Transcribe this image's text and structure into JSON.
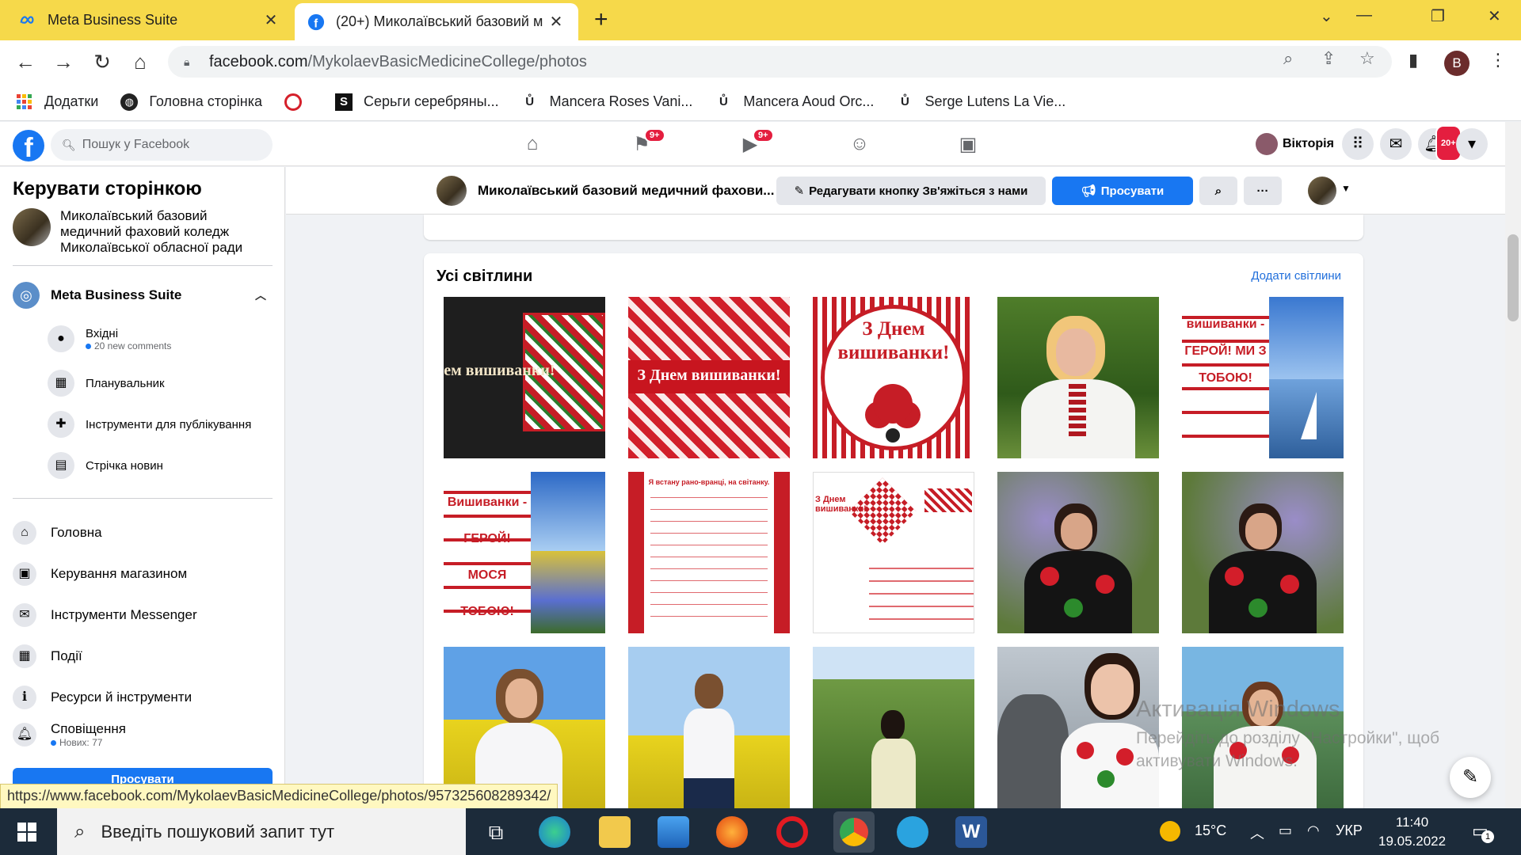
{
  "browser": {
    "tabs": [
      {
        "title": "Meta Business Suite",
        "active": false
      },
      {
        "title": "(20+) Миколаївський базовий м",
        "active": true
      }
    ],
    "url_host": "facebook.com",
    "url_path": "/MykolaevBasicMedicineCollege/photos",
    "profile_letter": "B",
    "bookmarks": [
      {
        "label": "Додатки",
        "icon": "apps-grid-icon"
      },
      {
        "label": "Головна сторінка",
        "icon": "globe-icon"
      },
      {
        "label": "",
        "icon": "opera-red-icon"
      },
      {
        "label": "Серьги серебряны...",
        "icon": "s-logo-icon"
      },
      {
        "label": "Mancera Roses Vani...",
        "icon": "u-logo-icon"
      },
      {
        "label": "Mancera Aoud Orc...",
        "icon": "u-logo-icon"
      },
      {
        "label": "Serge Lutens La Vie...",
        "icon": "u-logo-icon"
      }
    ],
    "status_url": "https://www.facebook.com/MykolaevBasicMedicineCollege/photos/957325608289342/"
  },
  "fb_nav": {
    "logo": "f",
    "search_placeholder": "Пошук у Facebook",
    "badge_pages": "9+",
    "badge_watch": "9+",
    "badge_notifications": "20+",
    "user_name": "Вікторія"
  },
  "sidebar": {
    "title": "Керувати сторінкою",
    "page_name": "Миколаївський базовий медичний фаховий коледж Миколаївської обласної ради",
    "mbs_label": "Meta Business Suite",
    "sub_items": [
      {
        "label": "Вхідні",
        "sub": "20 new comments",
        "icon": "chat-bubble-icon"
      },
      {
        "label": "Планувальник",
        "icon": "calendar-icon"
      },
      {
        "label": "Інструменти для публікування",
        "icon": "publishing-tools-icon"
      },
      {
        "label": "Стрічка новин",
        "icon": "news-feed-icon"
      }
    ],
    "main_items": [
      {
        "label": "Головна",
        "icon": "home-icon"
      },
      {
        "label": "Керування магазином",
        "icon": "shopping-bag-icon"
      },
      {
        "label": "Інструменти Messenger",
        "icon": "messenger-icon"
      },
      {
        "label": "Події",
        "icon": "event-calendar-icon"
      },
      {
        "label": "Ресурси й інструменти",
        "icon": "resources-icon"
      },
      {
        "label": "Сповіщення",
        "sub": "Нових: 77",
        "icon": "bell-icon"
      }
    ],
    "promote_label": "Просувати"
  },
  "page_bar": {
    "page_name": "Миколаївський базовий медичний фахови...",
    "edit_button": "Редагувати кнопку Зв'яжіться з нами",
    "promote_button": "Просувати"
  },
  "photos": {
    "title": "Усі світлини",
    "add_link": "Додати світлини",
    "items": [
      {
        "caption": "З Днем вишиванки!",
        "kind": "embroidery-dark"
      },
      {
        "caption": "З Днем вишиванки!",
        "kind": "embroidery-red"
      },
      {
        "caption": "З Днем вишиванки!",
        "kind": "embroidery-circle"
      },
      {
        "caption": "",
        "kind": "portrait-green"
      },
      {
        "caption": "вишиванки - ГЕРОЙ! МИ З ТОБОЮ!",
        "kind": "collage-sea"
      },
      {
        "caption": "Вишиванки - ГЕРОЙ! МОСЯ ТОБОЮ!",
        "kind": "collage-field"
      },
      {
        "caption": "Я встану рано-вранці, на світанку.",
        "kind": "poem"
      },
      {
        "caption": "З Днем вишиванки!",
        "kind": "greeting-white"
      },
      {
        "caption": "",
        "kind": "portrait-lilac"
      },
      {
        "caption": "",
        "kind": "portrait-lilac"
      },
      {
        "caption": "",
        "kind": "rapeseed-girl"
      },
      {
        "caption": "",
        "kind": "rapeseed-girl"
      },
      {
        "caption": "",
        "kind": "garden-woman"
      },
      {
        "caption": "",
        "kind": "girl-cat"
      },
      {
        "caption": "",
        "kind": "girl-lake"
      }
    ]
  },
  "watermark": {
    "line1": "Активація Windows",
    "line2": "Перейдіть до розділу \"Настройки\", щоб активувати Windows."
  },
  "taskbar": {
    "search_placeholder": "Введіть пошуковий запит тут",
    "temperature": "15°C",
    "language": "УКР",
    "time": "11:40",
    "date": "19.05.2022",
    "notif_count": "1"
  }
}
